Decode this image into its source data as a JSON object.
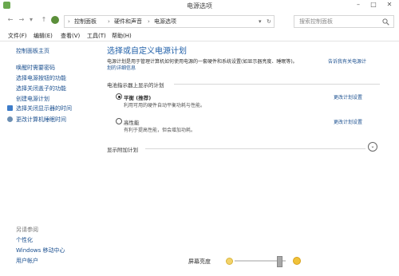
{
  "window": {
    "title": "电源选项",
    "minimize": "–",
    "maximize": "□",
    "close": "✕"
  },
  "address": {
    "back": "←",
    "forward": "→",
    "dropdown": "▾",
    "up": "↑",
    "path": [
      "控制面板",
      "硬件和声音",
      "电源选项"
    ],
    "sep": "›",
    "search_placeholder": "搜索控制面板",
    "search_icon": "search-icon"
  },
  "menu": [
    "文件(F)",
    "编辑(E)",
    "查看(V)",
    "工具(T)",
    "帮助(H)"
  ],
  "sidebar": {
    "home": "控制面板主页",
    "links": [
      "唤醒时需要密码",
      "选择电源按钮的功能",
      "选择关闭盖子的功能",
      "创建电源计划",
      "选择关闭显示器的时间",
      "更改计算机睡眠时间"
    ],
    "see_also_label": "另请参阅",
    "see_also": [
      "个性化",
      "Windows 移动中心",
      "用户帐户"
    ]
  },
  "main": {
    "heading": "选择或自定义电源计划",
    "intro_line1": "电源计划是用于管理计算机如何使用电源的一套硬件和系统设置(如显示器亮度、睡眠等)。",
    "intro_link": "告诉我有关电源计划的详细信息",
    "intro_link_part1": "告诉我有关电源计",
    "intro_link_part2": "划的详细信息",
    "group_label": "电池指示器上显示的计划",
    "plans": [
      {
        "name": "平衡 (推荐)",
        "desc": "利用可用的硬件自动平衡功耗与性能。",
        "action": "更改计划设置",
        "selected": true
      },
      {
        "name": "高性能",
        "desc": "有利于提高性能，但会增加功耗。",
        "action": "更改计划设置",
        "selected": false
      }
    ],
    "show_more": "显示附加计划",
    "expand_icon": "⌄"
  },
  "bottom": {
    "brightness_label": "屏幕亮度",
    "brightness_level": 0.93
  }
}
